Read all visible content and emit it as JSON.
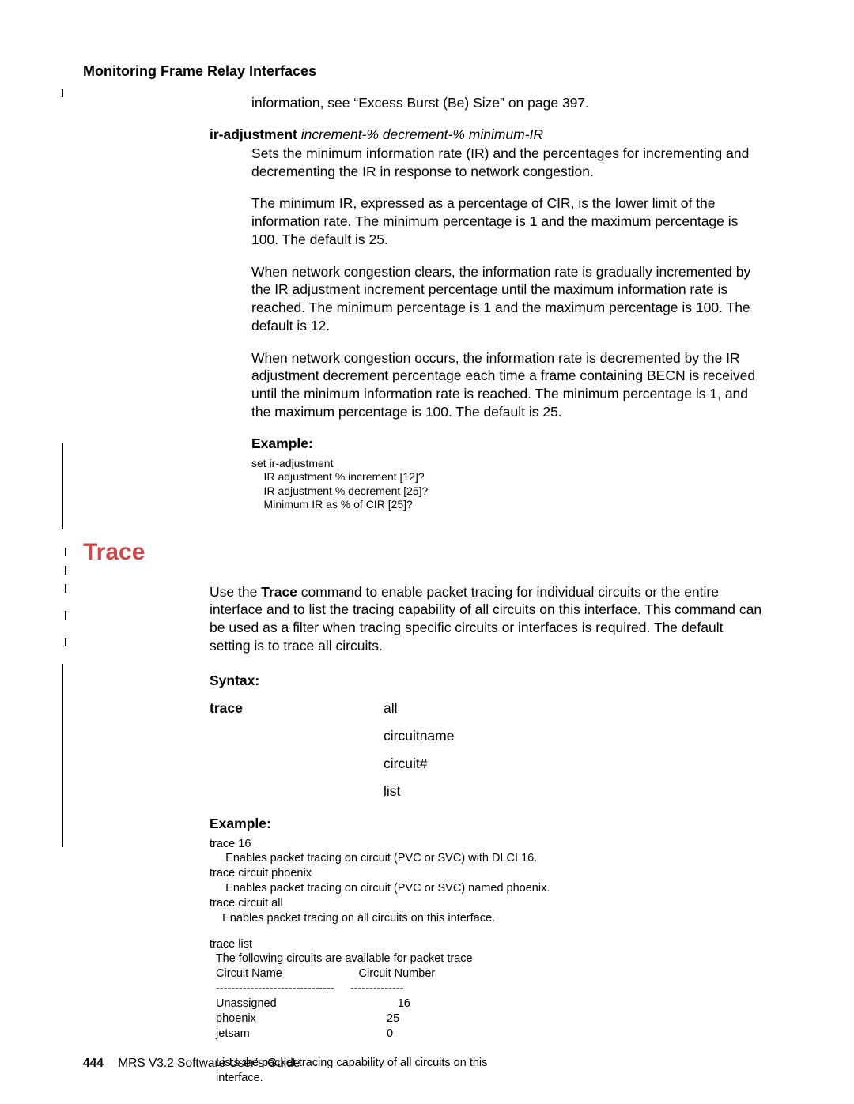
{
  "running_head": "Monitoring Frame Relay Interfaces",
  "intro_line": "information, see “Excess Burst (Be) Size” on page 397.",
  "ir_adjust": {
    "term": "ir-adjustment",
    "args": "increment-% decrement-% minimum-IR",
    "p1": "Sets the minimum information rate (IR) and the percentages for incrementing and decrementing the IR in response to network congestion.",
    "p2": "The minimum IR, expressed as a percentage of CIR, is the lower limit of the information rate. The minimum percentage is 1 and the maximum percentage is 100. The default is 25.",
    "p3": "When network congestion clears, the information rate is gradually incremented by the IR adjustment increment percentage until the maximum information rate is reached. The minimum percentage is 1 and the maximum percentage is 100. The default is 12.",
    "p4": "When network congestion occurs, the information rate is decremented by the IR adjustment decrement percentage each time a frame containing BECN is received until the minimum information rate is reached. The minimum percentage is 1, and the maximum percentage is 100. The default is 25."
  },
  "example1": {
    "label": "Example:",
    "code": "set ir-adjustment\n    IR adjustment % increment [12]?\n    IR adjustment % decrement [25]?\n    Minimum IR as % of CIR [25]?"
  },
  "trace": {
    "title": "Trace",
    "intro_pre": "Use the ",
    "intro_bold": "Trace",
    "intro_post": " command to enable packet tracing for individual circuits or the entire interface and to list the tracing capability of all circuits on this interface. This command can be used as a filter when tracing specific circuits or interfaces is required. The default setting is to trace all circuits.",
    "syntax_label": "Syntax:",
    "cmd_underline": "t",
    "cmd_rest": "race",
    "args": [
      "all",
      "circuitname",
      "circuit#",
      "list"
    ],
    "example_label": "Example:",
    "example_code1": "trace 16\n     Enables packet tracing on circuit (PVC or SVC) with DLCI 16.\ntrace circuit phoenix\n     Enables packet tracing on circuit (PVC or SVC) named phoenix.\ntrace circuit all\n    Enables packet tracing on all circuits on this interface.",
    "example_code2": "trace list\n  The following circuits are available for packet trace\n  Circuit Name                        Circuit Number\n  -------------------------------     --------------\n  Unassigned                                      16\n  phoenix                                         25\n  jetsam                                           0\n\n  Lists the packet tracing capability of all circuits on this\n  interface."
  },
  "footer": {
    "page": "444",
    "title": "MRS V3.2 Software User’s Guide"
  }
}
